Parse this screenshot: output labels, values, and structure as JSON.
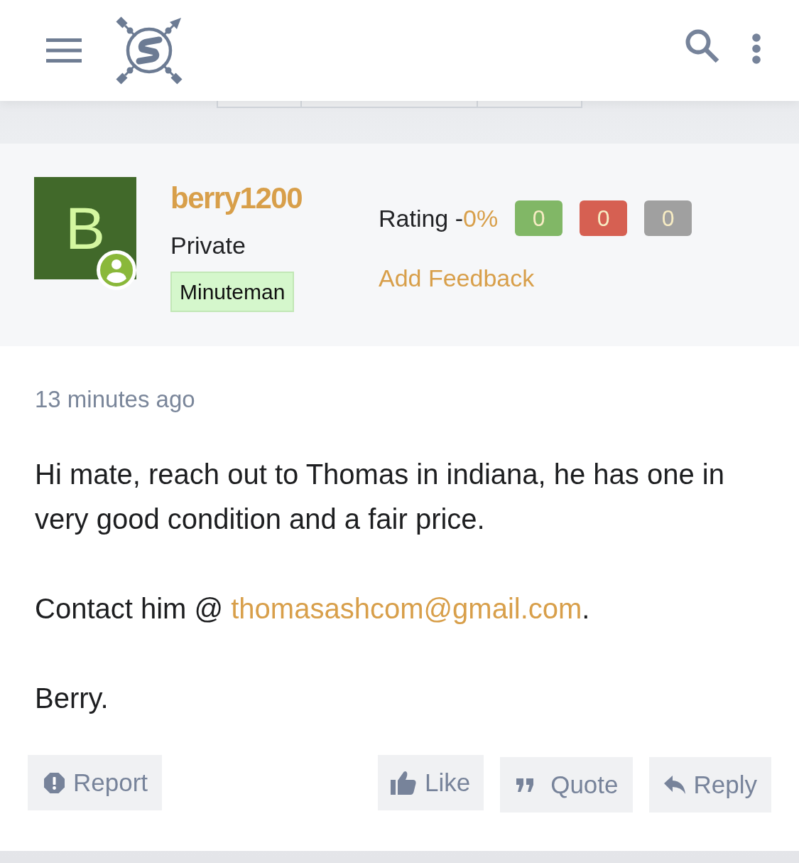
{
  "user": {
    "avatar_letter": "B",
    "name": "berry1200",
    "rank": "Private",
    "badge": "Minuteman"
  },
  "rating": {
    "label": "Rating -",
    "value": "0%",
    "counts": [
      {
        "value": "0",
        "color": "#81b766"
      },
      {
        "value": "0",
        "color": "#d66052"
      },
      {
        "value": "0",
        "color": "#a0a0a0"
      }
    ],
    "add_feedback": "Add Feedback"
  },
  "post": {
    "time": "13 minutes ago",
    "paragraphs": [
      {
        "text": "Hi mate, reach out to Thomas in indiana, he has one in very good condition and a fair price."
      },
      {
        "text": "Contact him @ ",
        "link": "thomasashcom@gmail.com",
        "after": "."
      },
      {
        "text": "Berry."
      }
    ]
  },
  "report_button": {
    "label": "Report"
  },
  "actions": [
    {
      "kind": "like",
      "label": "Like"
    },
    {
      "kind": "quote",
      "label": "Quote"
    },
    {
      "kind": "reply",
      "label": "Reply"
    }
  ]
}
